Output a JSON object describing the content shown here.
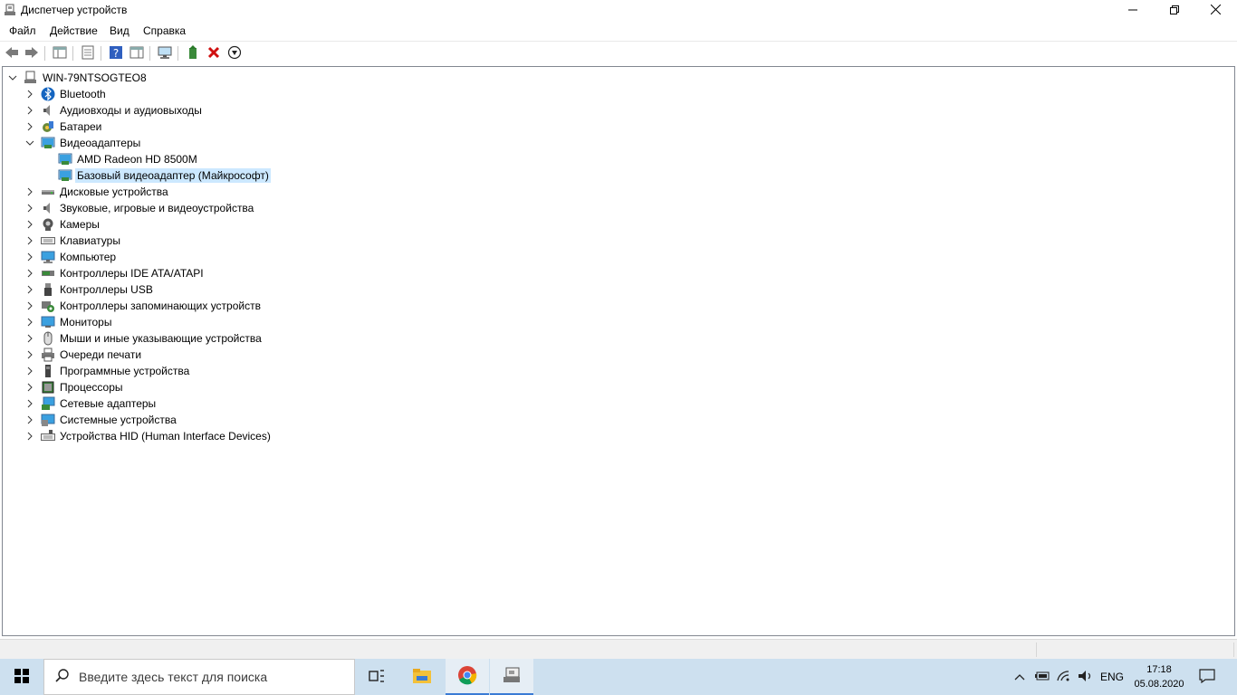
{
  "window": {
    "title": "Диспетчер устройств",
    "minimize_icon": "minimize-icon",
    "maximize_icon": "restore-icon",
    "close_icon": "close-icon"
  },
  "menu": [
    "Файл",
    "Действие",
    "Вид",
    "Справка"
  ],
  "toolbar": {
    "buttons": [
      "back-icon",
      "forward-icon",
      "show-hide-console-tree-icon",
      "properties-icon",
      "help-icon",
      "action-pane-icon",
      "scan-hardware-icon",
      "update-driver-icon",
      "uninstall-icon",
      "disable-icon"
    ]
  },
  "tree": {
    "root": "WIN-79NTSOGTEO8",
    "categories": [
      {
        "label": "Bluetooth",
        "icon": "bluetooth-icon",
        "expanded": false
      },
      {
        "label": "Аудиовходы и аудиовыходы",
        "icon": "speaker-icon",
        "expanded": false
      },
      {
        "label": "Батареи",
        "icon": "battery-icon",
        "expanded": false
      },
      {
        "label": "Видеоадаптеры",
        "icon": "display-adapter-icon",
        "expanded": true,
        "children": [
          {
            "label": "AMD Radeon HD 8500M",
            "icon": "display-adapter-icon",
            "selected": false
          },
          {
            "label": "Базовый видеоадаптер (Майкрософт)",
            "icon": "display-adapter-icon",
            "selected": true
          }
        ]
      },
      {
        "label": "Дисковые устройства",
        "icon": "disk-drive-icon",
        "expanded": false
      },
      {
        "label": "Звуковые, игровые и видеоустройства",
        "icon": "speaker-icon",
        "expanded": false
      },
      {
        "label": "Камеры",
        "icon": "camera-icon",
        "expanded": false
      },
      {
        "label": "Клавиатуры",
        "icon": "keyboard-icon",
        "expanded": false
      },
      {
        "label": "Компьютер",
        "icon": "computer-icon",
        "expanded": false
      },
      {
        "label": "Контроллеры IDE ATA/ATAPI",
        "icon": "ide-controller-icon",
        "expanded": false
      },
      {
        "label": "Контроллеры USB",
        "icon": "usb-icon",
        "expanded": false
      },
      {
        "label": "Контроллеры запоминающих устройств",
        "icon": "storage-controller-icon",
        "expanded": false
      },
      {
        "label": "Мониторы",
        "icon": "monitor-icon",
        "expanded": false
      },
      {
        "label": "Мыши и иные указывающие устройства",
        "icon": "mouse-icon",
        "expanded": false
      },
      {
        "label": "Очереди печати",
        "icon": "printer-icon",
        "expanded": false
      },
      {
        "label": "Программные устройства",
        "icon": "software-device-icon",
        "expanded": false
      },
      {
        "label": "Процессоры",
        "icon": "processor-icon",
        "expanded": false
      },
      {
        "label": "Сетевые адаптеры",
        "icon": "network-adapter-icon",
        "expanded": false
      },
      {
        "label": "Системные устройства",
        "icon": "system-device-icon",
        "expanded": false
      },
      {
        "label": "Устройства HID (Human Interface Devices)",
        "icon": "hid-icon",
        "expanded": false
      }
    ]
  },
  "taskbar": {
    "search_placeholder": "Введите здесь текст для поиска",
    "apps": [
      "task-view-icon",
      "file-explorer-icon",
      "chrome-icon",
      "device-manager-icon"
    ],
    "tray": {
      "language": "ENG",
      "time": "17:18",
      "date": "05.08.2020"
    }
  },
  "colors": {
    "selection": "#cce8ff",
    "taskbar": "#cde0ef",
    "accent": "#3a7bd5"
  }
}
